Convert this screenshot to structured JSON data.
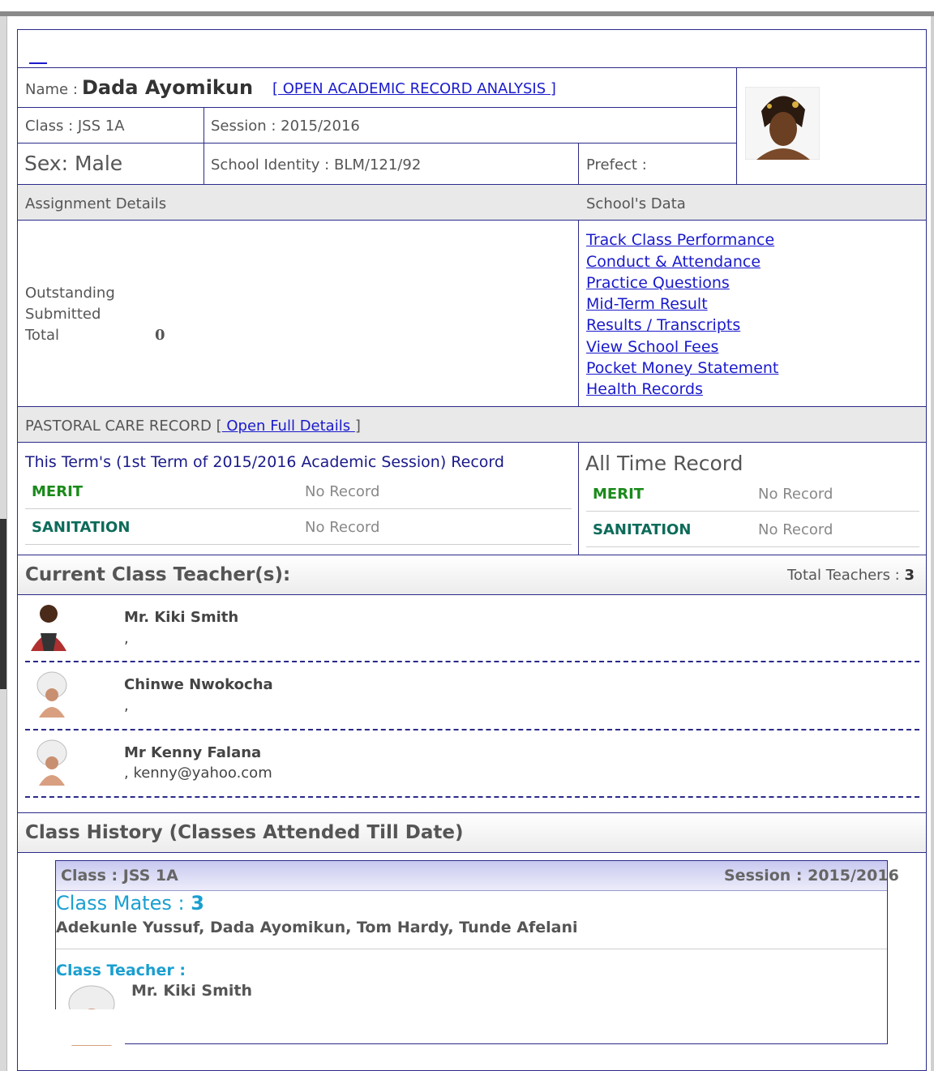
{
  "student": {
    "name_label": "Name :",
    "name": "Dada Ayomikun",
    "analysis_link": "[ OPEN ACADEMIC RECORD ANALYSIS ]",
    "class_text": "Class : JSS 1A",
    "session_text": "Session : 2015/2016",
    "sex_text": "Sex: Male",
    "identity_text": "School Identity : BLM/121/92",
    "prefect_text": "Prefect :"
  },
  "assignment": {
    "header": "Assignment Details",
    "outstanding_label": "Outstanding",
    "submitted_label": "Submitted",
    "total_label": "Total",
    "total_value": "0"
  },
  "school_data": {
    "header": "School's Data",
    "links": [
      "Track Class Performance",
      "Conduct & Attendance",
      "Practice Questions",
      "Mid-Term Result",
      "Results / Transcripts",
      "View School Fees",
      "Pocket Money Statement",
      "Health Records"
    ]
  },
  "pastoral": {
    "header": "PASTORAL CARE RECORD [",
    "link": " Open Full Details ",
    "header_close": "]",
    "term_record_title": "This Term's (1st Term of 2015/2016 Academic Session) Record",
    "all_time_title": "All Time Record",
    "rows": [
      {
        "label": "MERIT",
        "value": "No Record"
      },
      {
        "label": "SANITATION",
        "value": "No Record"
      }
    ]
  },
  "teachers": {
    "title": "Current Class Teacher(s):",
    "total_label": "Total Teachers :",
    "total_value": "3",
    "list": [
      {
        "name": "Mr. Kiki Smith",
        "contact": ","
      },
      {
        "name": "Chinwe Nwokocha",
        "contact": ","
      },
      {
        "name": "Mr Kenny Falana",
        "contact": ", kenny@yahoo.com"
      }
    ]
  },
  "history": {
    "title": "Class History (Classes Attended Till Date)",
    "class_text": "Class : JSS 1A",
    "session_text": "Session : 2015/2016",
    "classmates_label": "Class Mates :",
    "classmates_count": "3",
    "classmates": "Adekunle Yussuf,   Dada Ayomikun,   Tom Hardy,   Tunde Afelani",
    "teacher_label": "Class Teacher :",
    "teacher_name": "Mr. Kiki Smith"
  },
  "colors": {
    "border": "#2a2a8a",
    "link": "#1a1acc",
    "merit": "#1a8a1a",
    "sanitation": "#0d6b5a",
    "classmates_accent": "#1a9fd0"
  }
}
